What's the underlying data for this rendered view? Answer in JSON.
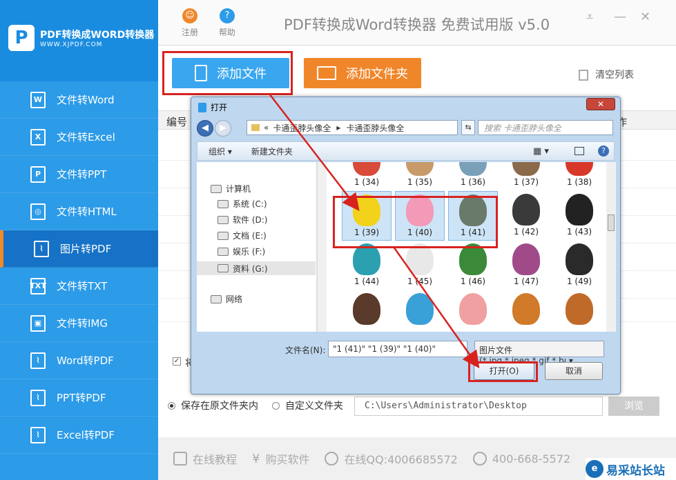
{
  "sidebar": {
    "logo_title": "PDF转换成WORD转换器",
    "logo_sub": "WWW.XJPDF.COM",
    "items": [
      {
        "label": "文件转Word",
        "icon": "W"
      },
      {
        "label": "文件转Excel",
        "icon": "X"
      },
      {
        "label": "文件转PPT",
        "icon": "P"
      },
      {
        "label": "文件转HTML",
        "icon": "◎"
      },
      {
        "label": "图片转PDF",
        "icon": "⌇"
      },
      {
        "label": "文件转TXT",
        "icon": "TXT"
      },
      {
        "label": "文件转IMG",
        "icon": "▣"
      },
      {
        "label": "Word转PDF",
        "icon": "⌇"
      },
      {
        "label": "PPT转PDF",
        "icon": "⌇"
      },
      {
        "label": "Excel转PDF",
        "icon": "⌇"
      }
    ],
    "active_index": 4
  },
  "header": {
    "register": "注册",
    "help": "帮助",
    "title": "PDF转换成Word转换器 免费试用版 v5.0"
  },
  "toolbar": {
    "add_file": "添加文件",
    "add_folder": "添加文件夹",
    "clear_list": "清空列表"
  },
  "table": {
    "col_num": "编号",
    "col_op": "作"
  },
  "options": {
    "merge_label": "将",
    "save_original": "保存在原文件夹内",
    "custom_folder": "自定义文件夹",
    "path": "C:\\Users\\Administrator\\Desktop",
    "browse": "浏览"
  },
  "footer": {
    "tutorial": "在线教程",
    "buy": "购买软件",
    "qq": "在线QQ:4006685572",
    "phone": "400-668-5572",
    "watermark": "易采站长站"
  },
  "dialog": {
    "title": "打开",
    "close": "✕",
    "breadcrumb_prefix": "«",
    "breadcrumb_1": "卡通歪脖头像全",
    "breadcrumb_2": "卡通歪脖头像全",
    "search_placeholder": "搜索 卡通歪脖头像全",
    "organize": "组织 ▾",
    "new_folder": "新建文件夹",
    "tree": [
      {
        "label": "计算机"
      },
      {
        "label": "系统 (C:)"
      },
      {
        "label": "软件 (D:)"
      },
      {
        "label": "文档 (E:)"
      },
      {
        "label": "娱乐 (F:)"
      },
      {
        "label": "资料 (G:)"
      },
      {
        "label": "网络"
      }
    ],
    "files": [
      {
        "label": "1 (34)",
        "color": "#d84a3a"
      },
      {
        "label": "1 (35)",
        "color": "#c89a6a"
      },
      {
        "label": "1 (36)",
        "color": "#7aa0b8"
      },
      {
        "label": "1 (37)",
        "color": "#8a6a4a"
      },
      {
        "label": "1 (38)",
        "color": "#d8382a"
      },
      {
        "label": "1 (39)",
        "color": "#f2d21a"
      },
      {
        "label": "1 (40)",
        "color": "#f29ab8"
      },
      {
        "label": "1 (41)",
        "color": "#6a7a6a"
      },
      {
        "label": "1 (42)",
        "color": "#3a3a3a"
      },
      {
        "label": "1 (43)",
        "color": "#222222"
      },
      {
        "label": "1 (44)",
        "color": "#2aa0b0"
      },
      {
        "label": "1 (45)",
        "color": "#e8e8e8"
      },
      {
        "label": "1 (46)",
        "color": "#3a8a3a"
      },
      {
        "label": "1 (47)",
        "color": "#a04a8a"
      },
      {
        "label": "1 (49)",
        "color": "#2a2a2a"
      },
      {
        "label": "",
        "color": "#5a3a2a"
      },
      {
        "label": "",
        "color": "#3aa0d8"
      },
      {
        "label": "",
        "color": "#f0a0a0"
      },
      {
        "label": "",
        "color": "#d07a2a"
      },
      {
        "label": "",
        "color": "#c06a2a"
      }
    ],
    "selected": [
      5,
      6,
      7
    ],
    "filename_label": "文件名(N):",
    "filename_value": "\"1 (41)\" \"1 (39)\" \"1 (40)\"",
    "filetype": "图片文件(*.jpg,*.jpeg,*.gif,*.bı ▾",
    "open": "打开(O)",
    "cancel": "取消"
  },
  "colors": {
    "sidebar": "#2c9be8",
    "active": "#1672c6",
    "accent": "#f0862a",
    "annotation": "#d8221e"
  }
}
